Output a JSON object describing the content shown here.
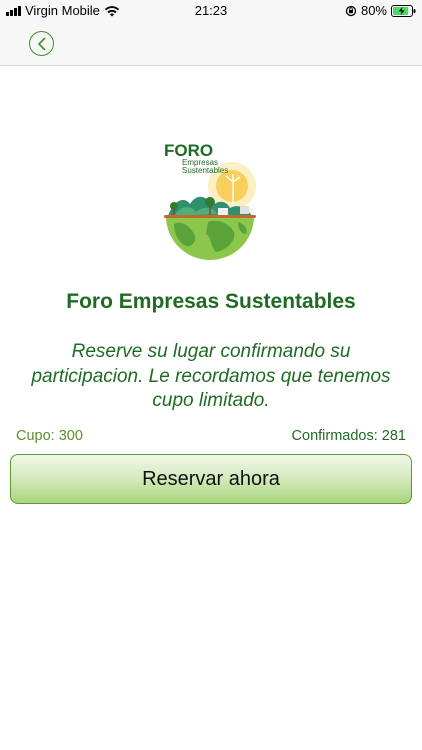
{
  "status": {
    "carrier": "Virgin Mobile",
    "time": "21:23",
    "battery": "80%",
    "battery_level": 0.8
  },
  "logo": {
    "line1": "FORO",
    "line2": "Empresas",
    "line3": "Sustentables"
  },
  "event": {
    "title": "Foro Empresas Sustentables",
    "message": "Reserve su lugar confirmando su participacion. Le recordamos que tenemos cupo limitado."
  },
  "stats": {
    "cupo": "Cupo: 300",
    "confirmados": "Confirmados: 281"
  },
  "actions": {
    "reserve_label": "Reservar ahora"
  },
  "colors": {
    "accent": "#1f6b24",
    "button_gradient_bottom": "#a9d57c"
  }
}
